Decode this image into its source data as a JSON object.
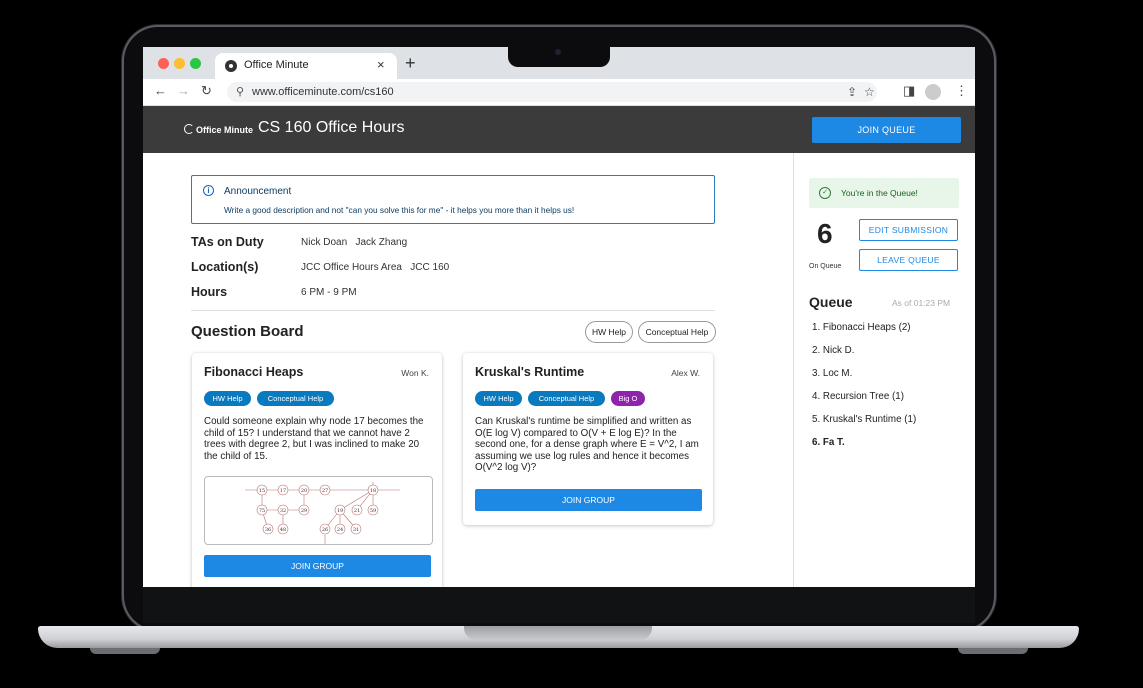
{
  "browser": {
    "tab_title": "Office Minute",
    "tab_close": "×",
    "new_tab": "+",
    "url": "www.officeminute.com/cs160"
  },
  "header": {
    "logo_text": "Office Minute",
    "course_title": "CS 160 Office Hours",
    "join_queue_label": "JOIN QUEUE"
  },
  "announcement": {
    "title": "Announcement",
    "text": "Write a good description and not \"can you solve this for me\" - it helps you more than it helps us!"
  },
  "info": {
    "tas_label": "TAs on Duty",
    "tas_value": "Nick Doan   Jack Zhang",
    "location_label": "Location(s)",
    "location_value": "JCC Office Hours Area   JCC 160",
    "hours_label": "Hours",
    "hours_value": "6 PM - 9 PM"
  },
  "question_board": {
    "title": "Question Board",
    "filters": [
      "HW Help",
      "Conceptual Help"
    ],
    "cards": [
      {
        "title": "Fibonacci Heaps",
        "author": "Won K.",
        "tags": [
          "HW Help",
          "Conceptual Help"
        ],
        "body": "Could someone explain why node 17 becomes the child of 15? I understand that we cannot have 2 trees with degree 2, but I was inclined to make 20 the child of 15.",
        "join_label": "JOIN GROUP"
      },
      {
        "title": "Kruskal's Runtime",
        "author": "Alex W.",
        "tags": [
          "HW Help",
          "Conceptual Help",
          "Big O"
        ],
        "body": "Can Kruskal's runtime be simplified and written as O(E log V) compared to O(V + E log E)? In the second one, for a dense graph where E = V^2, I am assuming we use log rules and hence it becomes O(V^2 log V)?",
        "join_label": "JOIN GROUP"
      }
    ],
    "tree_nodes": [
      "15",
      "17",
      "20",
      "27",
      "18",
      "75",
      "32",
      "29",
      "19",
      "21",
      "59",
      "36",
      "48",
      "26",
      "24",
      "31"
    ]
  },
  "sidebar": {
    "status": "You're in the Queue!",
    "position": "6",
    "position_label": "On Queue",
    "edit_label": "EDIT SUBMISSION",
    "leave_label": "LEAVE QUEUE",
    "queue_title": "Queue",
    "as_of": "As of 01:23 PM",
    "queue_items": [
      "1. Fibonacci Heaps (2)",
      "2. Nick D.",
      "3. Loc M.",
      "4. Recursion Tree (1)",
      "5. Kruskal's Runtime (1)",
      "6. Fa T."
    ]
  },
  "colors": {
    "primary": "#1e88e5",
    "header_bg": "#3b3b3b",
    "tag_blue": "#0a7abf",
    "tag_purple": "#8e24aa",
    "success_bg": "#e8f5e9"
  }
}
